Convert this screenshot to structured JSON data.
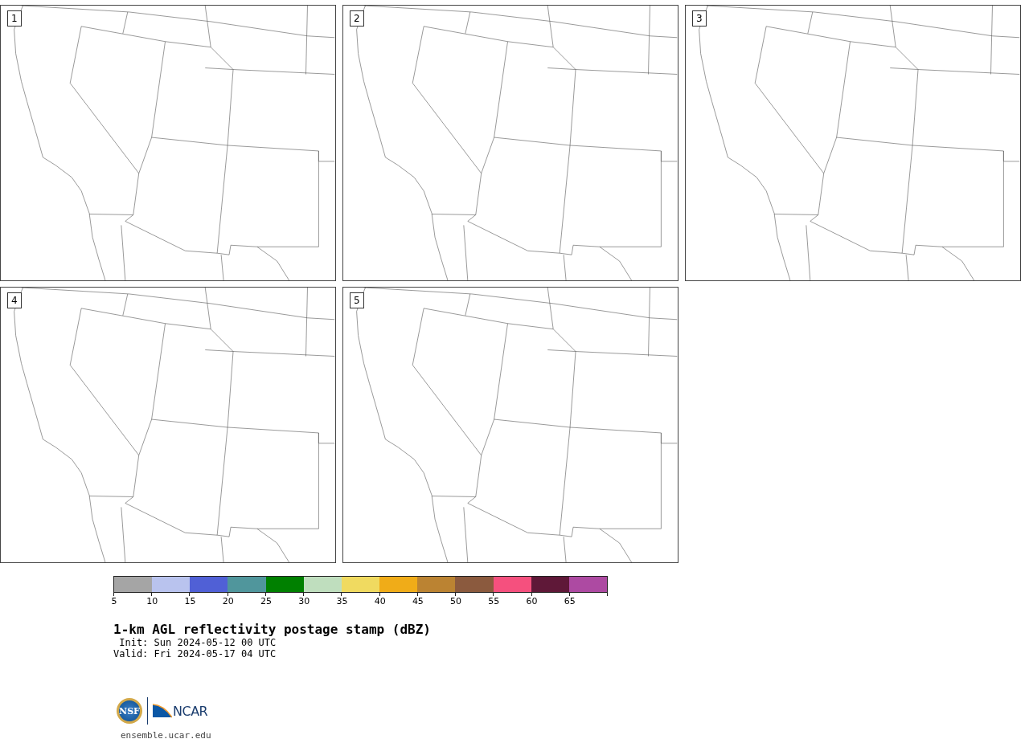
{
  "panels": [
    {
      "label": "1"
    },
    {
      "label": "2"
    },
    {
      "label": "3"
    },
    {
      "label": "4"
    },
    {
      "label": "5"
    }
  ],
  "colorbar": {
    "bins": [
      {
        "color": "#a5a5a5",
        "tick": "5"
      },
      {
        "color": "#b9c3ee",
        "tick": "10"
      },
      {
        "color": "#5060d6",
        "tick": "15"
      },
      {
        "color": "#50969c",
        "tick": "20"
      },
      {
        "color": "#008000",
        "tick": "25"
      },
      {
        "color": "#bfdebe",
        "tick": "30"
      },
      {
        "color": "#f0da60",
        "tick": "35"
      },
      {
        "color": "#f0ac18",
        "tick": "40"
      },
      {
        "color": "#bb8332",
        "tick": "45"
      },
      {
        "color": "#8b5a3e",
        "tick": "50"
      },
      {
        "color": "#f5507e",
        "tick": "55"
      },
      {
        "color": "#5f1838",
        "tick": "60"
      },
      {
        "color": "#ad4aa2",
        "tick": "65"
      }
    ]
  },
  "title": "1-km AGL reflectivity postage stamp (dBZ)",
  "init": " Init: Sun 2024-05-12 00 UTC",
  "valid": "Valid: Fri 2024-05-17 04 UTC",
  "logo": {
    "left": "NSF",
    "right": "NCAR"
  },
  "url": "ensemble.ucar.edu"
}
